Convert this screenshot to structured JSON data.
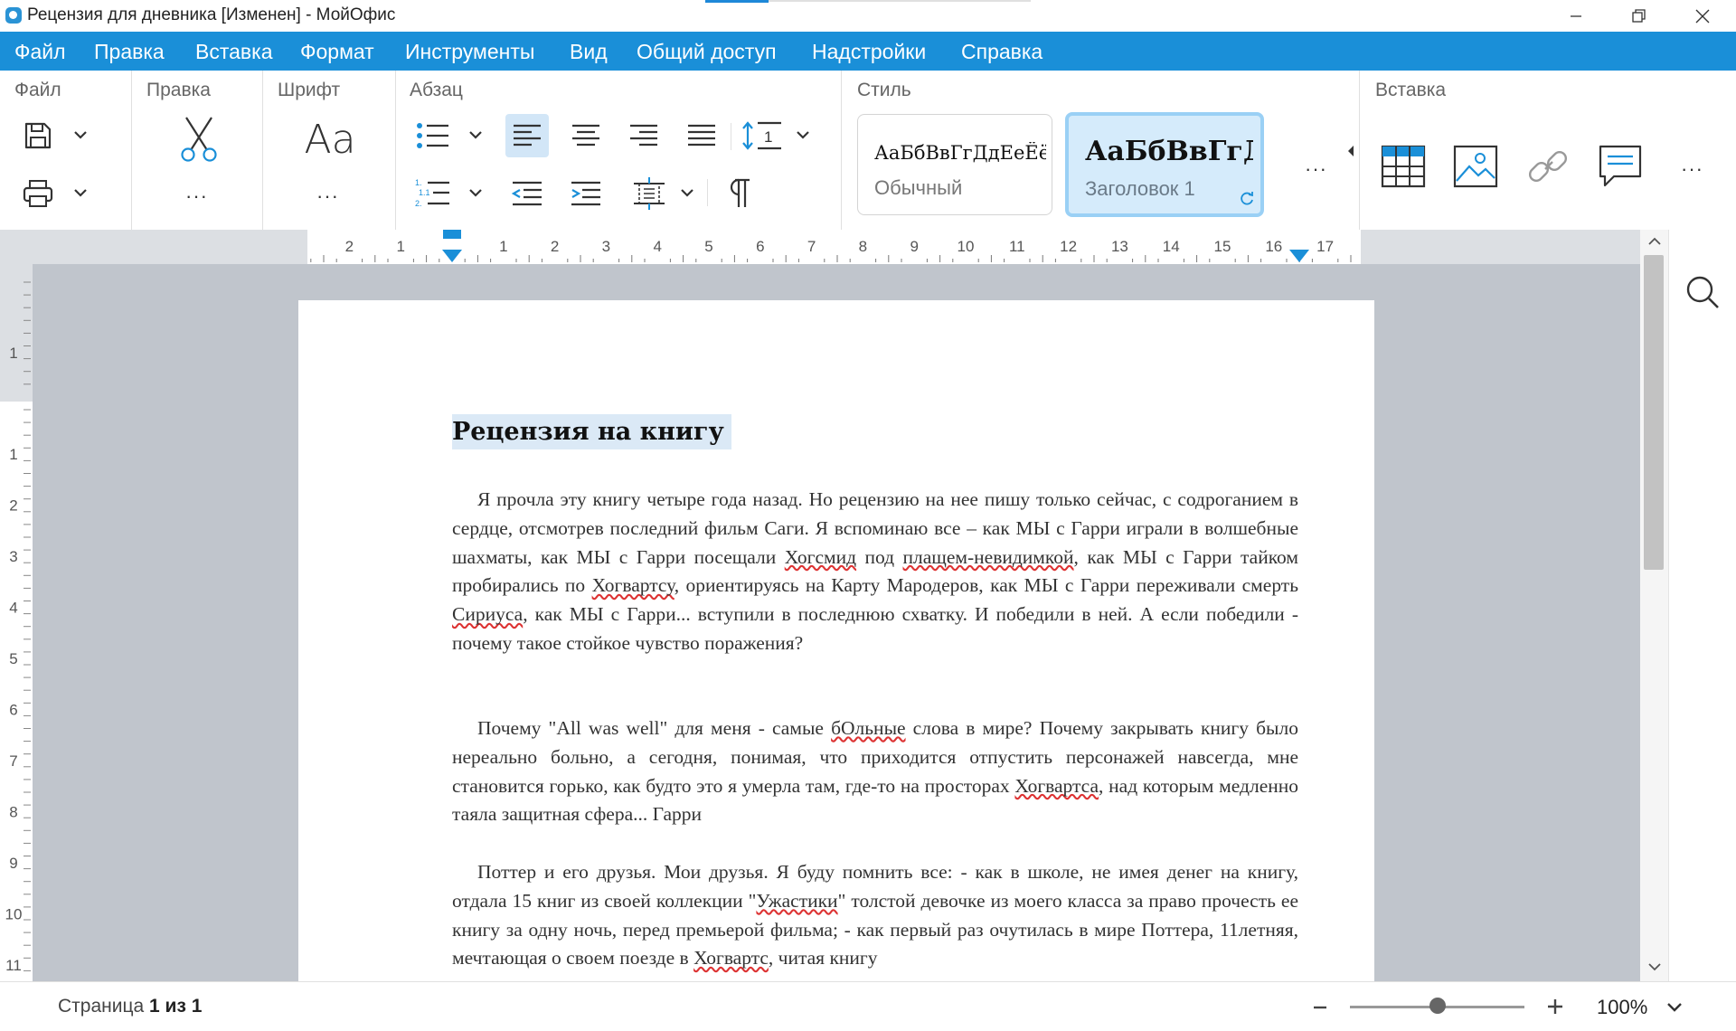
{
  "window": {
    "title": "Рецензия для дневника [Изменен] - МойОфис"
  },
  "menu": [
    "Файл",
    "Правка",
    "Вставка",
    "Формат",
    "Инструменты",
    "Вид",
    "Общий доступ",
    "Надстройки",
    "Справка"
  ],
  "ribbon": {
    "groups": {
      "file": "Файл",
      "edit": "Правка",
      "font": "Шрифт",
      "paragraph": "Абзац",
      "style": "Стиль",
      "insert": "Вставка"
    },
    "font_icon": "Aa",
    "styles": [
      {
        "sample": "АаБбВвГгДдЕеЁё",
        "name": "Обычный"
      },
      {
        "sample": "АаБбВвГгД",
        "name": "Заголовок 1"
      }
    ],
    "more": "···"
  },
  "ruler": {
    "h_labels": [
      "2",
      "1",
      "1",
      "2",
      "3",
      "4",
      "5",
      "6",
      "7",
      "8",
      "9",
      "10",
      "11",
      "12",
      "13",
      "14",
      "15",
      "16",
      "17"
    ],
    "v_labels": [
      "1",
      "1",
      "2",
      "3",
      "4",
      "5",
      "6",
      "7",
      "8",
      "9",
      "10",
      "11"
    ]
  },
  "document": {
    "heading": "Рецензия на книгу",
    "p1": {
      "a": "Я прочла эту книгу четыре года назад. Но рецензию на нее пишу только сейчас, с содроганием в сердце, отсмотрев последний фильм Саги. Я вспоминаю все – как МЫ с Гарри играли в волшебные шахматы, как МЫ с Гарри посещали ",
      "e1": "Хогсмид",
      "b": " под ",
      "e2": "плащем-невидимкой",
      "c": ", как МЫ с Гарри тайком пробирались по ",
      "e3": "Хогвартсу",
      "d": ", ориентируясь на Карту Мародеров, как МЫ с Гарри переживали смерть ",
      "e4": "Сириуса",
      "f": ", как МЫ с Гарри... вступили в последнюю схватку. И победили в ней. А если победили - почему такое стойкое чувство поражения?"
    },
    "p2": {
      "a": "Почему \"All was well\" для меня - самые ",
      "e1": "бОльные",
      "b": " слова в мире? Почему закрывать книгу было нереально больно, а сегодня, понимая, что приходится отпустить персонажей навсегда, мне становится горько, как будто это я умерла там, где-то на просторах ",
      "e2": "Хогвартса",
      "c": ", над которым медленно таяла защитная сфера... Гарри"
    },
    "p3": {
      "a": "Поттер и его друзья. Мои друзья. Я буду помнить все: - как в школе, не имея денег на книгу, отдала 15 книг из своей коллекции \"",
      "e1": "Ужастики",
      "b": "\" толстой девочке из моего класса за право прочесть ее книгу за одну ночь, перед премьерой фильма; - как первый раз очутилась в мире Поттера, 11летняя, мечтающая о своем поезде в ",
      "e2": "Хогвартс",
      "c": ", читая книгу"
    }
  },
  "status": {
    "page_prefix": "Страница",
    "page_of": "1 из 1",
    "zoom": "100%",
    "zoom_fraction": 0.5
  },
  "colors": {
    "accent": "#1a8fd8",
    "selection": "#dbe9f6",
    "spell_error": "#d33"
  }
}
